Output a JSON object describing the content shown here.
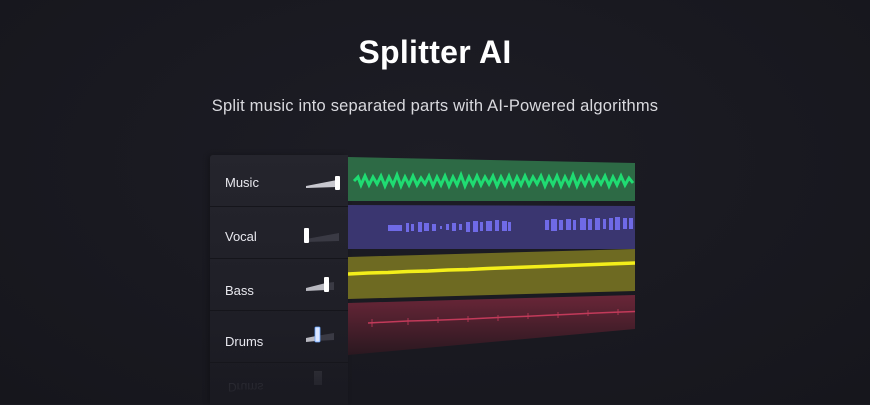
{
  "hero": {
    "title": "Splitter AI",
    "subtitle": "Split music into separated parts with AI-Powered algorithms"
  },
  "tracks": [
    {
      "label": "Music",
      "color": "#1fdc72",
      "lane_bg": "#2d6a45",
      "volume": 1.0
    },
    {
      "label": "Vocal",
      "color": "#6f6ae6",
      "lane_bg": "#3a3670",
      "volume": 0.0
    },
    {
      "label": "Bass",
      "color": "#f3ee1a",
      "lane_bg": "#6e6a22",
      "volume": 0.85
    },
    {
      "label": "Drums",
      "color": "#c23a5a",
      "lane_bg": "#5a2330",
      "volume": 0.45
    }
  ],
  "ghost_label": "Drums",
  "colors": {
    "background": "#1a1a21",
    "panel": "#24242c",
    "text": "#ffffff"
  }
}
